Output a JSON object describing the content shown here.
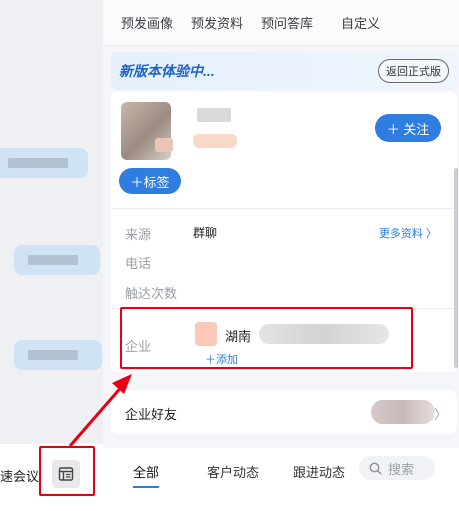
{
  "top_tabs": [
    "预发画像",
    "预发资料",
    "预问答库",
    "自定义"
  ],
  "banner": {
    "title": "新版本体验中...",
    "back_label": "返回正式版"
  },
  "profile": {
    "follow_label": "＋ 关注",
    "tag_label": "＋标签"
  },
  "fields": {
    "source_label": "来源",
    "source_value": "群聊",
    "more_label": "更多资料 〉",
    "phone_label": "电话",
    "reach_label": "触达次数",
    "company_label": "企业",
    "company_name": "湖南",
    "add_label": "＋添加"
  },
  "friends": {
    "label": "企业好友",
    "chevron": "〉"
  },
  "bottom_tabs": [
    "全部",
    "客户动态",
    "跟进动态"
  ],
  "search": {
    "placeholder": "搜索"
  },
  "left": {
    "meeting_label": "速会议"
  },
  "colors": {
    "accent": "#2f7de1",
    "highlight": "#e60012"
  }
}
